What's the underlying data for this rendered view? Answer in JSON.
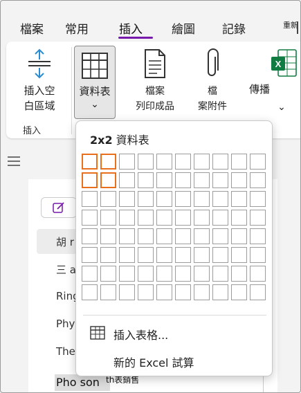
{
  "tabs": [
    {
      "label": "檔案",
      "active": false
    },
    {
      "label": "常用",
      "active": false
    },
    {
      "label": "插入",
      "active": true
    },
    {
      "label": "繪圖",
      "active": false
    },
    {
      "label": "記錄",
      "active": false
    }
  ],
  "tab_more_label": "重新",
  "accent_color": "#7719aa",
  "ribbon": {
    "insert_space": {
      "line1": "插入空",
      "line2": "白區域"
    },
    "group_label": "插入",
    "table": {
      "label": "資料表",
      "chevron": "⌄"
    },
    "file_printout": {
      "line1": "檔案",
      "line2": "列印成品"
    },
    "file_attachment": {
      "line1": "檔",
      "line2": "案附件"
    },
    "spreadsheet": {
      "label": "傳播",
      "chevron": "⌄"
    }
  },
  "table_dropdown": {
    "size_label": "2x2",
    "title_suffix": " 資料表",
    "grid": {
      "rows": 8,
      "cols": 10,
      "selected_rows": 2,
      "selected_cols": 2
    },
    "selection_color": "#e8701c",
    "insert_table_label": "插入表格...",
    "new_excel_label": "新的 Excel 試算"
  },
  "notebook": {
    "rows": [
      "胡 r",
      "三 a",
      "Ring",
      "Phy",
      "The"
    ],
    "bottom_item": "Pho son",
    "bottom_item_tail": "th表銷售"
  }
}
